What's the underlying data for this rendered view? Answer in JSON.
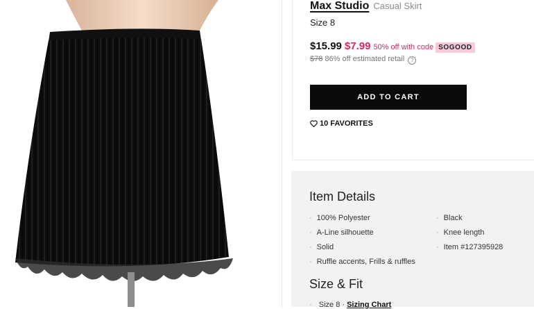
{
  "product": {
    "brand": "Max Studio",
    "type": "Casual Skirt",
    "size": "Size 8",
    "price": "$15.99",
    "sale_price": "$7.99",
    "discount_text": "50% off with code",
    "promo_code": "SOGOOD",
    "retail_price": "$78",
    "retail_text": "86% off estimated retail",
    "add_to_cart_label": "ADD TO CART",
    "favorites_label": "10 FAVORITES"
  },
  "details": {
    "item_title": "Item Details",
    "left_items": [
      "100% Polyester",
      "A-Line silhouette",
      "Solid",
      "Ruffle accents, Frills & ruffles"
    ],
    "right_items": [
      "Black",
      "Knee length",
      "Item #127395928"
    ],
    "size_title": "Size & Fit",
    "size_value": "Size 8",
    "sizing_chart_label": "Sizing Chart"
  },
  "colors": {
    "accent_pink": "#e0245e",
    "promo_bg": "#f7c9dc",
    "button_bg": "#0b0b0b",
    "details_bg": "#f2f2f2"
  },
  "icons": {
    "favorite": "heart-outline-icon",
    "info": "info-circle-icon"
  }
}
